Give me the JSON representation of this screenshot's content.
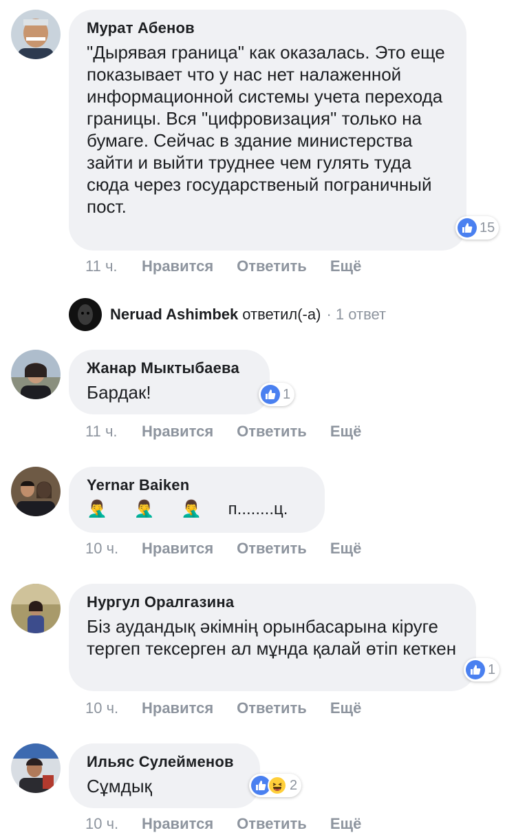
{
  "comments": [
    {
      "author": "Мурат Абенов",
      "text": "\"Дырявая граница\" как оказалась. Это еще показывает что у нас нет налаженной информационной системы учета перехода границы. Вся \"цифровизация\" только на бумаге. Сейчас в здание министерства зайти и выйти труднее чем гулять туда сюда через государственый пограничный пост.",
      "reactions": {
        "count": "15",
        "types": [
          "like-icon"
        ]
      },
      "meta": {
        "time": "11 ч.",
        "like": "Нравится",
        "reply": "Ответить",
        "more": "Ещё"
      }
    },
    {
      "author": "Жанар Мыктыбаева",
      "text": "Бардак!",
      "reactions": {
        "count": "1",
        "types": [
          "like-icon"
        ]
      },
      "meta": {
        "time": "11 ч.",
        "like": "Нравится",
        "reply": "Ответить",
        "more": "Ещё"
      }
    },
    {
      "author": "Yernar Baiken",
      "text": "🤦‍♂️ 🤦‍♂️ 🤦‍♂️ п........ц.",
      "meta": {
        "time": "10 ч.",
        "like": "Нравится",
        "reply": "Ответить",
        "more": "Ещё"
      }
    },
    {
      "author": "Нургул Оралгазина",
      "text": "Біз аудандық әкімнің орынбасарына кіруге тергеп тексерген ал мұнда қалай өтіп кеткен",
      "reactions": {
        "count": "1",
        "types": [
          "like-icon"
        ]
      },
      "meta": {
        "time": "10 ч.",
        "like": "Нравится",
        "reply": "Ответить",
        "more": "Ещё"
      }
    },
    {
      "author": "Ильяс Сулейменов",
      "text": "Сұмдық",
      "reactions": {
        "count": "2",
        "types": [
          "like-icon",
          "haha-icon"
        ]
      },
      "meta": {
        "time": "10 ч.",
        "like": "Нравится",
        "reply": "Ответить",
        "more": "Ещё"
      }
    }
  ],
  "reply_thread": {
    "author": "Neruad Ashimbek",
    "verb": "ответил(-а)",
    "count": "· 1 ответ"
  },
  "colors": {
    "bubble": "#f0f1f4",
    "muted": "#8d949e",
    "like_blue": "#4a80f0",
    "haha_yellow": "#ffcf3a"
  }
}
